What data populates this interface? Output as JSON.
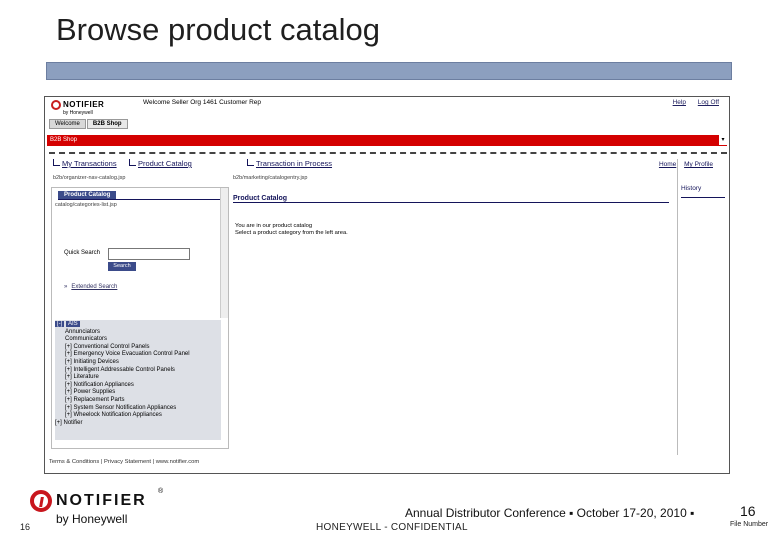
{
  "slide": {
    "title": "Browse product catalog",
    "page_number": "16",
    "footer_left": "HONEYWELL - CONFIDENTIAL",
    "conference": "Annual Distributor Conference  ▪  October 17-20, 2010  ▪",
    "conference_page": "16",
    "file_number": "File Number",
    "logo_brand": "NOTIFIER",
    "logo_reg": "®",
    "logo_by": "by Honeywell"
  },
  "app": {
    "logo_brand": "NOTIFIER",
    "logo_by": "by Honeywell",
    "welcome": "Welcome Seller Org 1461 Customer Rep",
    "links": [
      "Help",
      "Log Off"
    ],
    "tabs": [
      "Welcome",
      "B2B Shop"
    ],
    "redbar_label": "B2B Shop",
    "redbar_dropdown": "▾",
    "nav": {
      "my_transactions": "My Transactions",
      "product_catalog": "Product Catalog",
      "transaction_in_process": "Transaction in Process",
      "home": "Home",
      "my_profile": "My Profile",
      "history": "History"
    },
    "paths": {
      "left": "b2b/organizer-nav-catalog.jsp",
      "main": "b2b/marketing/catalogentry.jsp",
      "inner": "catalog/categories-list.jsp"
    },
    "left_panel": {
      "header": "Product Catalog",
      "quick_search_label": "Quick Search",
      "search_button": "Search",
      "extended_search": "Extended Search",
      "adv_icon": "»"
    },
    "tree": {
      "root_prefix": "[-]",
      "root_label": "AIS",
      "items": [
        "Annunciators",
        "Communicators",
        "[+] Conventional Control Panels",
        "[+] Emergency Voice Evacuation Control Panel",
        "[+] Initiating Devices",
        "[+] Intelligent Addressable Control Panels",
        "[+] Literature",
        "[+] Notification Appliances",
        "[+] Power Supplies",
        "[+] Replacement Parts",
        "[+] System Sensor Notification Appliances",
        "[+] Wheelock Notification Appliances"
      ],
      "last": "[+] Notifier"
    },
    "main_panel": {
      "header": "Product Catalog",
      "message_line1": "You are in our product catalog",
      "message_line2": "Select a product category from the left area."
    },
    "footer": "Terms & Conditions | Privacy Statement | www.notifier.com"
  }
}
